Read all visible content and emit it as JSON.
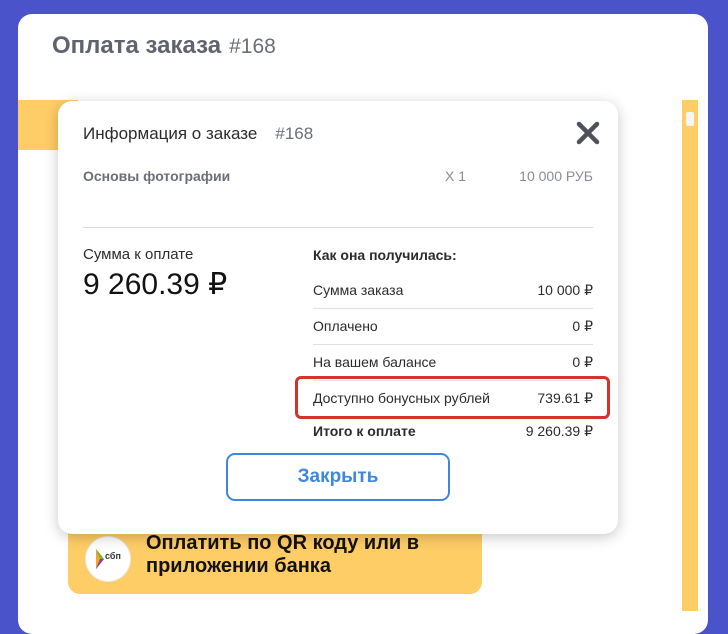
{
  "page": {
    "title": "Оплата заказа",
    "order_number": "#168"
  },
  "modal": {
    "title": "Информация о заказе",
    "order_number": "#168",
    "item": {
      "name": "Основы фотографии",
      "qty": "X 1",
      "price": "10 000 РУБ"
    },
    "sum_label": "Сумма к оплате",
    "sum_value": "9 260.39 ₽",
    "breakdown_title": "Как она получилась:",
    "breakdown": [
      {
        "label": "Сумма заказа",
        "value": "10 000 ₽"
      },
      {
        "label": "Оплачено",
        "value": "0 ₽"
      },
      {
        "label": "На вашем балансе",
        "value": "0 ₽"
      },
      {
        "label": "Доступно бонусных рублей",
        "value": "739.61 ₽"
      },
      {
        "label": "Итого к оплате",
        "value": "9 260.39 ₽"
      }
    ],
    "close_button_label": "Закрыть"
  },
  "qr_button": {
    "logo_text": "сбп",
    "label": "Оплатить по QR коду или в приложении банка"
  },
  "colors": {
    "background": "#4a53c9",
    "accent_yellow": "#ffcd66",
    "button_blue": "#3d87e0",
    "highlight_red": "#d6312b"
  },
  "icons": {
    "close": "close-icon",
    "sbp": "sbp-logo-icon"
  }
}
